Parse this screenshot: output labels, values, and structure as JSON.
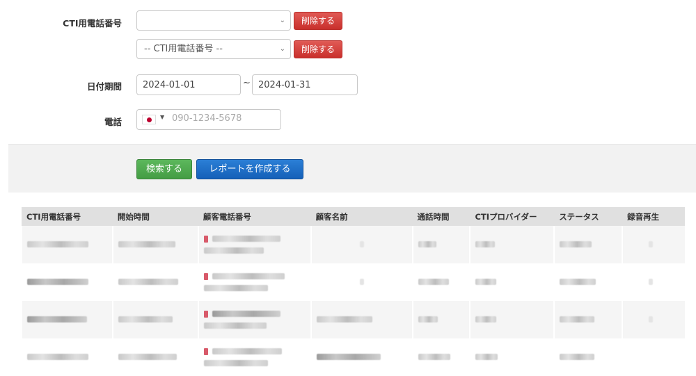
{
  "form": {
    "cti_label": "CTI用電話番号",
    "cti_select_1_value": "",
    "cti_select_2_value": "-- CTI用電話番号 --",
    "delete_label": "削除する",
    "date_label": "日付期間",
    "date_from": "2024-01-01",
    "date_separator": "~",
    "date_to": "2024-01-31",
    "phone_label": "電話",
    "phone_placeholder": "090-1234-5678",
    "phone_country": "JP"
  },
  "actions": {
    "search_label": "検索する",
    "report_label": "レポートを作成する"
  },
  "table": {
    "columns": [
      "CTI用電話番号",
      "開始時間",
      "顧客電話番号",
      "顧客名前",
      "通話時間",
      "CTIプロバイダー",
      "ステータス",
      "録音再生"
    ]
  },
  "colors": {
    "danger": "#d9534f",
    "success": "#5cb85c",
    "primary": "#1a6fc9",
    "header_bg": "#e0e0e0",
    "action_bar_bg": "#f2f2f2"
  }
}
